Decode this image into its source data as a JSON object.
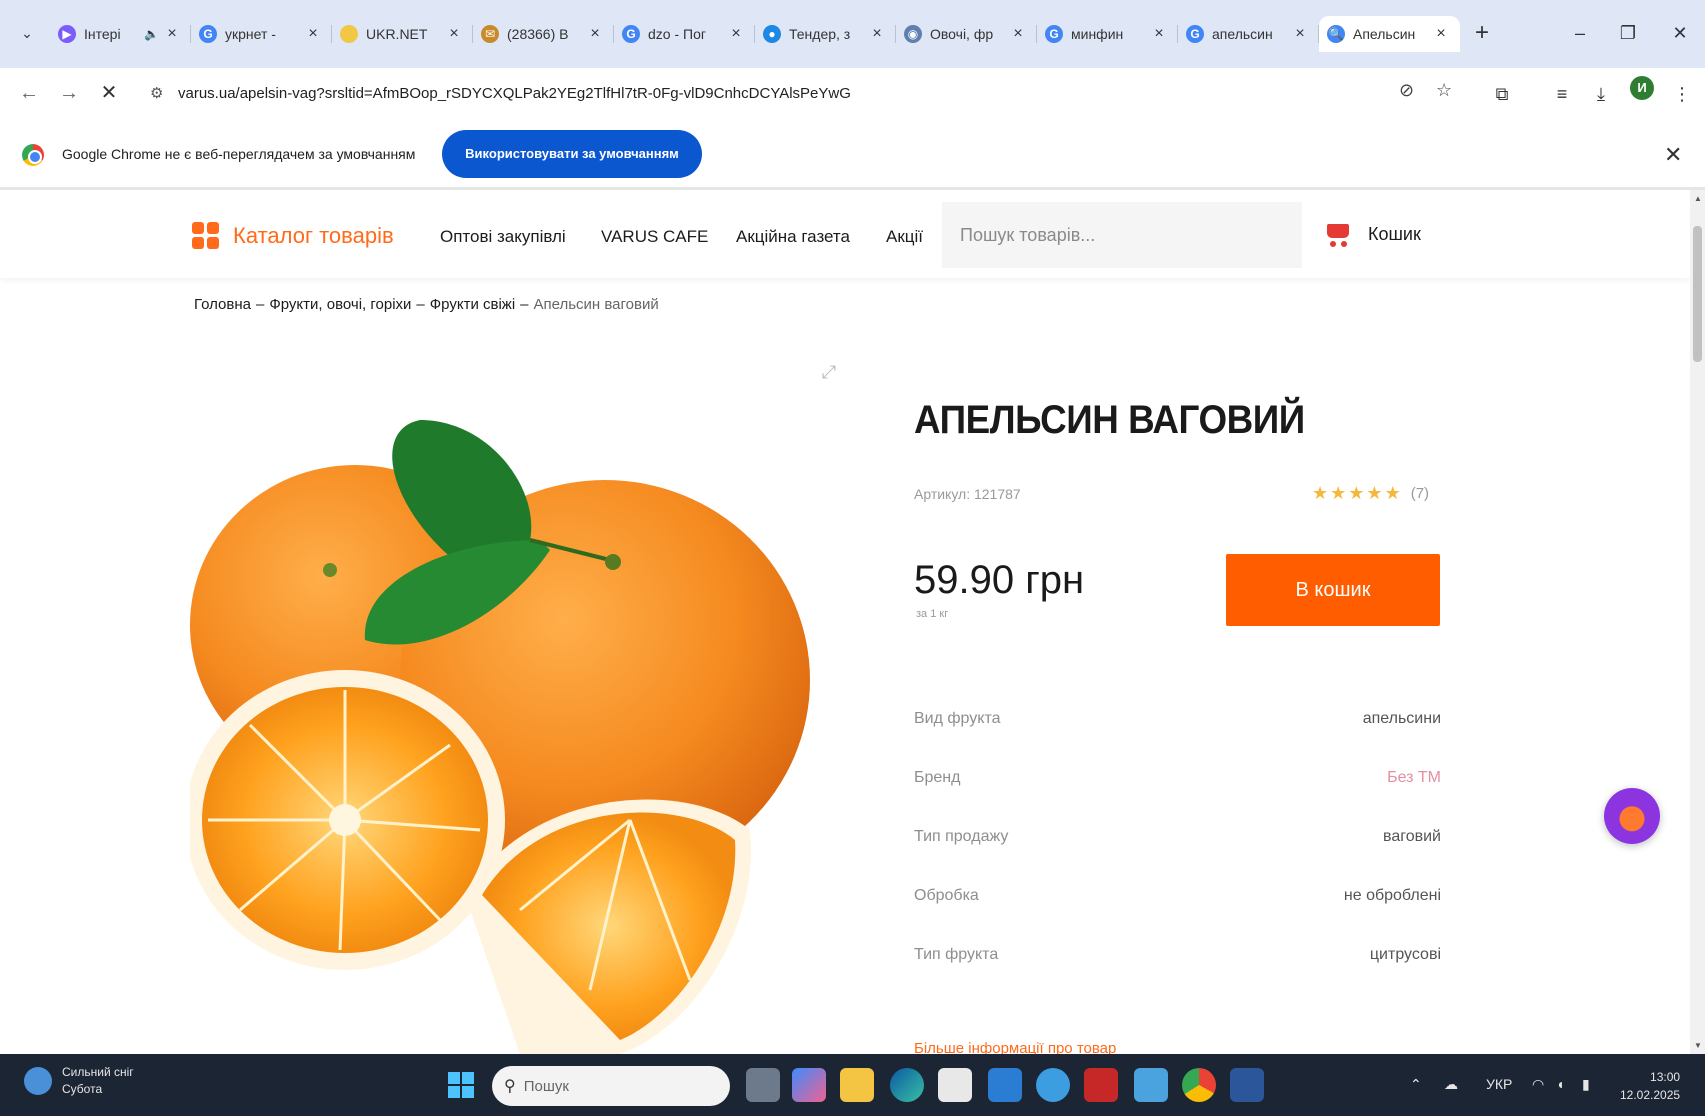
{
  "browser": {
    "tabs": [
      {
        "title": "Інтері",
        "favicon": "#7a5cfa",
        "glyph": "▶",
        "audio": "🔈"
      },
      {
        "title": "укрнет -",
        "favicon": "#4285f4",
        "glyph": "G"
      },
      {
        "title": "UKR.NET",
        "favicon": "#f2c744",
        "glyph": ""
      },
      {
        "title": "(28366) В",
        "favicon": "#c98a2b",
        "glyph": "✉"
      },
      {
        "title": "dzo - Пог",
        "favicon": "#4285f4",
        "glyph": "G"
      },
      {
        "title": "Тендер, з",
        "favicon": "#1e88e5",
        "glyph": "●"
      },
      {
        "title": "Овочі, фр",
        "favicon": "#5f7fb0",
        "glyph": "◉"
      },
      {
        "title": "минфин",
        "favicon": "#4285f4",
        "glyph": "G"
      },
      {
        "title": "апельсин",
        "favicon": "#4285f4",
        "glyph": "G"
      },
      {
        "title": "Апельсин",
        "favicon": "#4285f4",
        "glyph": "🔍",
        "active": true
      }
    ],
    "new_tab_label": "+",
    "url": "varus.ua/apelsin-vag?srsltid=AfmBOop_rSDYCXQLPak2YEg2TlfHl7tR-0Fg-vlD9CnhcDCYAlsPeYwG",
    "profile_initial": "И"
  },
  "infobar": {
    "message": "Google Chrome не є веб-переглядачем за умовчанням",
    "button_label": "Використовувати за умовчанням"
  },
  "site": {
    "catalog_label": "Каталог товарів",
    "nav": [
      "Оптові закупівлі",
      "VARUS CAFE",
      "Акційна газета",
      "Акції"
    ],
    "search_placeholder": "Пошук товарів...",
    "cart_label": "Кошик",
    "accent": "#ff6b1a"
  },
  "breadcrumb": [
    "Головна",
    "Фрукти, овочі, горіхи",
    "Фрукти свіжі",
    "Апельсин ваговий"
  ],
  "breadcrumb_sep": "–",
  "product": {
    "title": "АПЕЛЬСИН ВАГОВИЙ",
    "sku": "Артикул: 121787",
    "rating_stars": 5,
    "rating_count": "(7)",
    "price": "59.90 грн",
    "price_unit": "за 1 кг",
    "buy_label": "В кошик",
    "buy_color": "#ff5d00",
    "attributes": [
      {
        "key": "Вид фрукта",
        "value": "апельсини"
      },
      {
        "key": "Бренд",
        "value": "Без ТМ"
      },
      {
        "key": "Тип продажу",
        "value": "ваговий"
      },
      {
        "key": "Обробка",
        "value": "не оброблені"
      },
      {
        "key": "Тип фрукта",
        "value": "цитрусові"
      }
    ],
    "more_link": "Більше інформації про товар"
  },
  "taskbar": {
    "weather_line1": "Сильний сніг",
    "weather_line2": "Субота",
    "search_placeholder": "Пошук",
    "lang": "УКР",
    "time": "13:00",
    "date": "12.02.2025"
  }
}
